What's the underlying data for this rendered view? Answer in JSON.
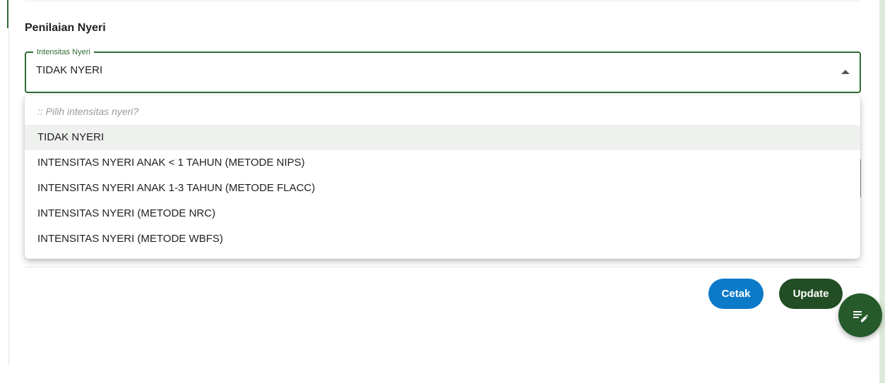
{
  "section": {
    "title": "Penilaian Nyeri"
  },
  "field": {
    "label": "Intensitas Nyeri",
    "value": "TIDAK NYERI"
  },
  "dropdown": {
    "placeholder": ":: Pilih intensitas nyeri?",
    "options": [
      "TIDAK NYERI",
      "INTENSITAS NYERI ANAK < 1 TAHUN (METODE NIPS)",
      "INTENSITAS NYERI ANAK 1-3 TAHUN (METODE FLACC)",
      "INTENSITAS NYERI (METODE NRC)",
      "INTENSITAS NYERI (METODE WBFS)"
    ],
    "selected_index": 0
  },
  "buttons": {
    "cetak": "Cetak",
    "update": "Update"
  },
  "fab": {
    "icon": "edit-list-icon"
  },
  "colors": {
    "primary_green": "#2e6b34",
    "update_green": "#234d24",
    "cetak_blue": "#0b7ac8",
    "selected_bg": "#eef1ee"
  }
}
